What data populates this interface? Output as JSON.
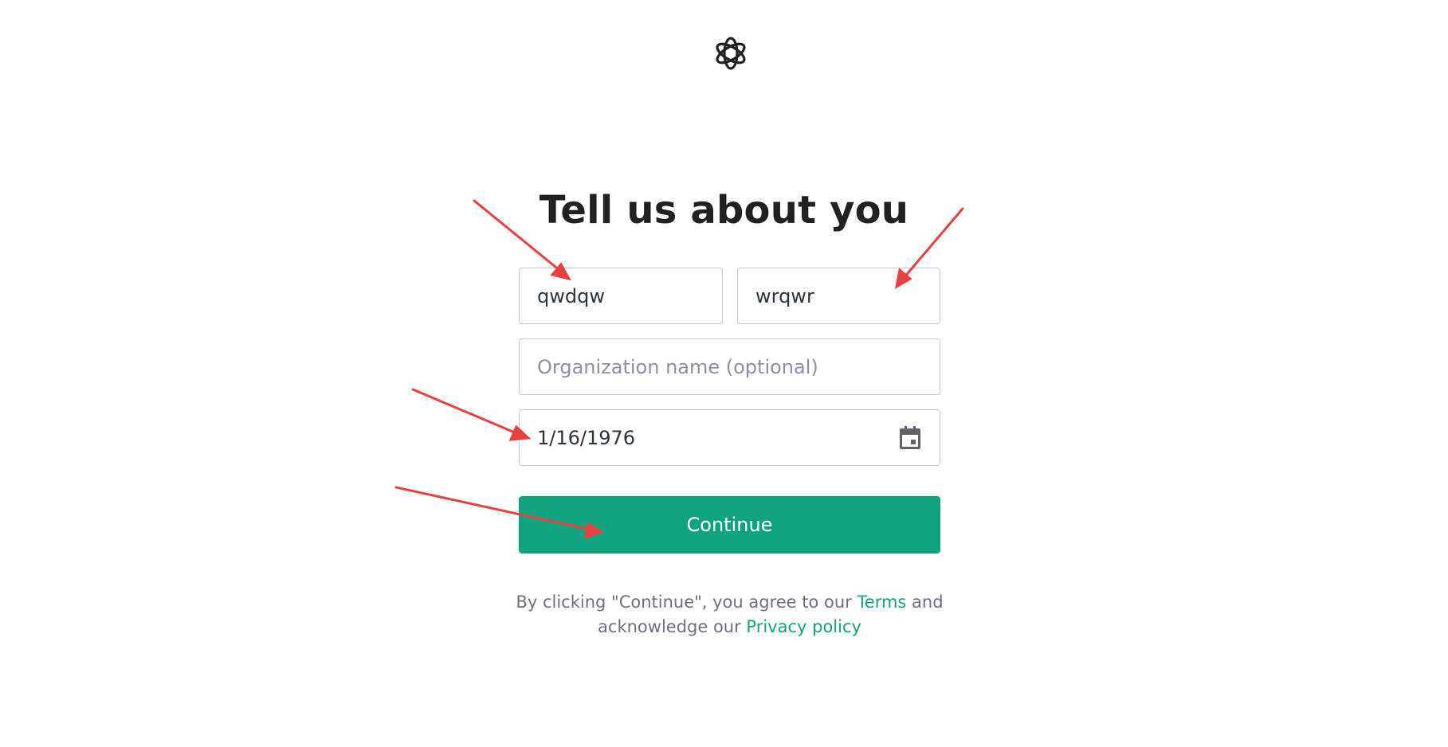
{
  "logo": {
    "icon": "openai-logo-icon"
  },
  "heading": {
    "title": "Tell us about you"
  },
  "form": {
    "first_name_value": "qwdqw",
    "last_name_value": "wrqwr",
    "org_placeholder": "Organization name (optional)",
    "birthday_value": "1/16/1976",
    "calendar_icon": "calendar-icon",
    "continue_label": "Continue"
  },
  "legal": {
    "prefix": "By clicking \"Continue\", you agree to our ",
    "terms_link": "Terms",
    "middle": " and",
    "line2_prefix": "acknowledge our ",
    "privacy_link": "Privacy policy"
  },
  "colors": {
    "accent": "#10a37f",
    "annotation_arrow": "#e8403f",
    "heading_text": "#202123",
    "border": "#c2c8d0"
  }
}
